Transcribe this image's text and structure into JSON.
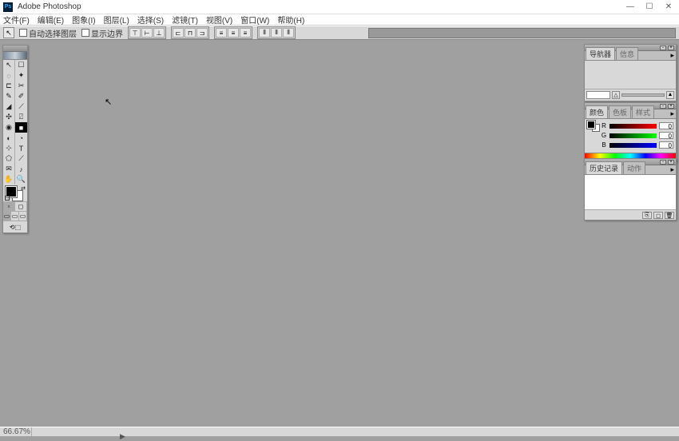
{
  "app": {
    "title": "Adobe Photoshop",
    "logo": "Ps"
  },
  "win": {
    "min": "—",
    "max": "☐",
    "close": "✕"
  },
  "menu": [
    "文件(F)",
    "编辑(E)",
    "图象(I)",
    "图层(L)",
    "选择(S)",
    "滤镜(T)",
    "视图(V)",
    "窗口(W)",
    "帮助(H)"
  ],
  "options": {
    "auto_select": "自动选择图层",
    "show_bounds": "显示边界"
  },
  "tools": [
    [
      "↖",
      "☐"
    ],
    [
      "◌",
      "✦"
    ],
    [
      "⊏",
      "✂"
    ],
    [
      "✎",
      "✐"
    ],
    [
      "◢",
      "⟋"
    ],
    [
      "✣",
      "⍁"
    ],
    [
      "◉",
      "■"
    ],
    [
      "◐",
      "◔"
    ],
    [
      "⊹",
      "T"
    ],
    [
      "⬠",
      "⟋"
    ],
    [
      "✉",
      "♪"
    ],
    [
      "✋",
      "🔍"
    ]
  ],
  "panels": {
    "navigator": {
      "tabs": [
        "导航器",
        "信息"
      ],
      "zoom_val": ""
    },
    "color": {
      "tabs": [
        "颜色",
        "色板",
        "样式"
      ],
      "r": "0",
      "g": "0",
      "b": "0"
    },
    "history": {
      "tabs": [
        "历史记录",
        "动作"
      ]
    }
  },
  "status": {
    "zoom": "66.67%"
  },
  "sliders": {
    "r_label": "R",
    "g_label": "G",
    "b_label": "B"
  }
}
